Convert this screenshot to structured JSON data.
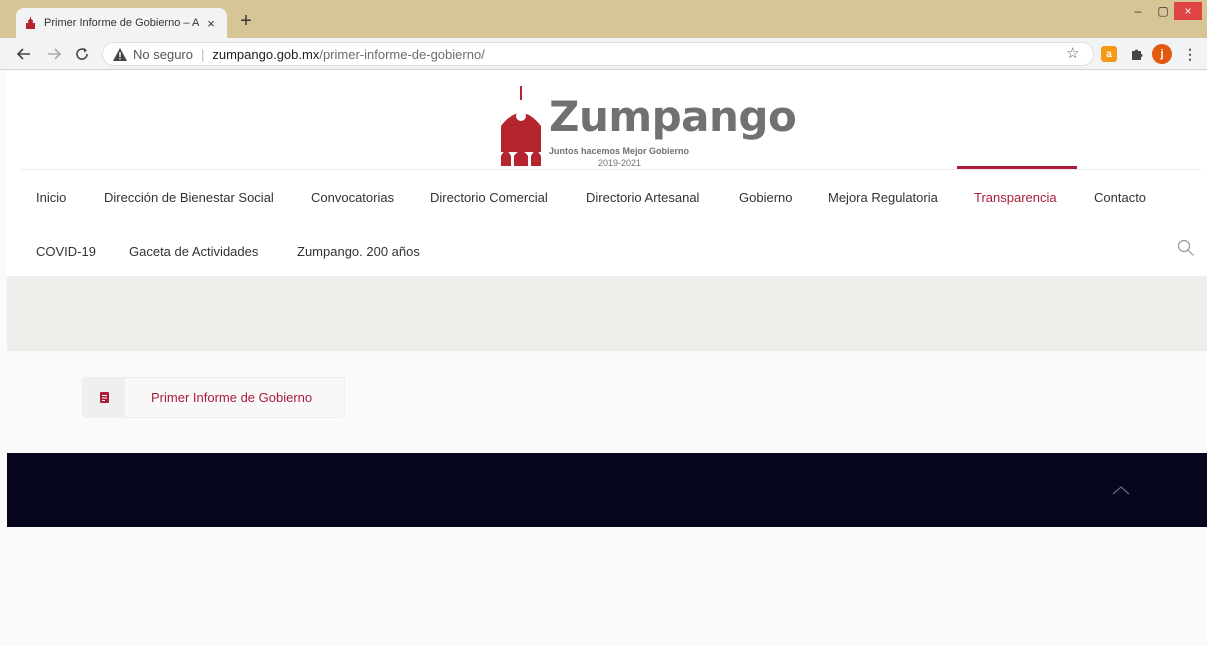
{
  "browser": {
    "tab_title": "Primer Informe de Gobierno – Ay",
    "tab_close": "×",
    "new_tab": "+",
    "window_minimize": "–",
    "window_maximize": "▢",
    "window_close": "×",
    "security_text": "No seguro",
    "separator": "|",
    "url_host": "zumpango.gob.mx",
    "url_path": "/primer-informe-de-gobierno/",
    "avatar_letter": "j",
    "extension_letter": "a"
  },
  "logo": {
    "name": "Zumpango",
    "tagline": "Juntos hacemos Mejor Gobierno",
    "years": "2019-2021",
    "brand_color": "#b5252f",
    "text_color": "#717171"
  },
  "nav": {
    "row1": [
      {
        "label": "Inicio"
      },
      {
        "label": "Dirección de Bienestar Social"
      },
      {
        "label": "Convocatorias"
      },
      {
        "label": "Directorio Comercial"
      },
      {
        "label": "Directorio Artesanal"
      },
      {
        "label": "Gobierno"
      },
      {
        "label": "Mejora Regulatoria"
      },
      {
        "label": "Transparencia",
        "active": true
      },
      {
        "label": "Contacto"
      }
    ],
    "row2": [
      {
        "label": "COVID-19"
      },
      {
        "label": "Gaceta de Actividades"
      },
      {
        "label": "Zumpango. 200 años"
      }
    ],
    "active_color": "#a91d3b",
    "search_icon": "search-icon"
  },
  "content": {
    "document_link": "Primer Informe de Gobierno",
    "document_icon": "document-icon"
  },
  "footer": {
    "background": "#06061c",
    "scroll_top_icon": "chevron-up-icon"
  }
}
